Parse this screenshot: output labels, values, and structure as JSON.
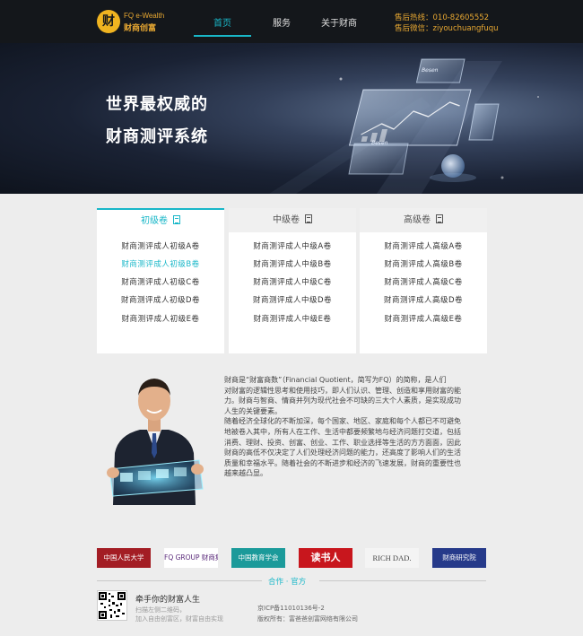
{
  "header": {
    "logo_mark": "财",
    "logo_en": "FQ e-Wealth",
    "logo_cn": "财商创富",
    "nav": [
      {
        "label": "首页",
        "active": true
      },
      {
        "label": "服务",
        "active": false
      },
      {
        "label": "关于财商",
        "active": false
      }
    ],
    "hotline": "售后热线：010-82605552",
    "wechat": "售后微信：ziyouchuangfuqu"
  },
  "banner": {
    "line1": "世界最权威的",
    "line2": "财商测评系统",
    "panel_brand": "Besen"
  },
  "exams": [
    {
      "title": "初级卷",
      "active": true,
      "items": [
        "财商测评成人初级A卷",
        "财商测评成人初级B卷",
        "财商测评成人初级C卷",
        "财商测评成人初级D卷",
        "财商测评成人初级E卷"
      ],
      "highlight_index": 1
    },
    {
      "title": "中级卷",
      "active": false,
      "items": [
        "财商测评成人中级A卷",
        "财商测评成人中级B卷",
        "财商测评成人中级C卷",
        "财商测评成人中级D卷",
        "财商测评成人中级E卷"
      ]
    },
    {
      "title": "高级卷",
      "active": false,
      "items": [
        "财商测评成人高级A卷",
        "财商测评成人高级B卷",
        "财商测评成人高级C卷",
        "财商测评成人高级D卷",
        "财商测评成人高级E卷"
      ]
    }
  ],
  "about": {
    "lines": [
      "财商是“财富商数”（Financial Quotient，简写为FQ）的简称，是人们",
      "对财富的逻辑性思考和使用技巧，即人们认识、管理、创造和享用财富的能",
      "力。财商与智商、情商并列为现代社会不可缺的三大个人素质，是实现成功",
      "人生的关键要素。",
      "随着经济全球化的不断加深，每个国家、地区、家庭和每个人都已不可避免",
      "地被卷入其中，所有人在工作、生活中都要频繁地与经济问题打交道，包括",
      "消费、理财、投资、创富、创业、工作、职业选择等生活的方方面面，因此",
      "财商的高低不仅决定了人们处理经济问题的能力，还高度了影响人们的生活",
      "质量和幸福水平。随着社会的不断进步和经济的飞速发展，财商的重要性也",
      "越来越凸显。"
    ]
  },
  "partners": {
    "title": "合作 · 官方",
    "logos": [
      {
        "label": "中国人民大学",
        "bg": "#a31d24",
        "fg": "#ffffff"
      },
      {
        "label": "FQ GROUP 财商集团",
        "bg": "#ffffff",
        "fg": "#5a2a7a"
      },
      {
        "label": "中国教育学会",
        "bg": "#1b9a9a",
        "fg": "#ffffff"
      },
      {
        "label": "读书人",
        "bg": "#c8161d",
        "fg": "#ffffff"
      },
      {
        "label": "RICH DAD.",
        "bg": "#f4f4f4",
        "fg": "#444444"
      },
      {
        "label": "财商研究院",
        "bg": "#263a8a",
        "fg": "#ffffff"
      }
    ]
  },
  "footer": {
    "slogan": "牵手你的财富人生",
    "scan_line1": "扫描左侧二维码，",
    "scan_line2": "加入自由创富区，财富自由实现",
    "icp": "京ICP备11010136号-2",
    "copyright": "版权所有：富爸爸创富网络有限公司"
  },
  "colors": {
    "accent": "#19b7c8",
    "gold": "#e8a832",
    "header_bg": "#14171b"
  }
}
